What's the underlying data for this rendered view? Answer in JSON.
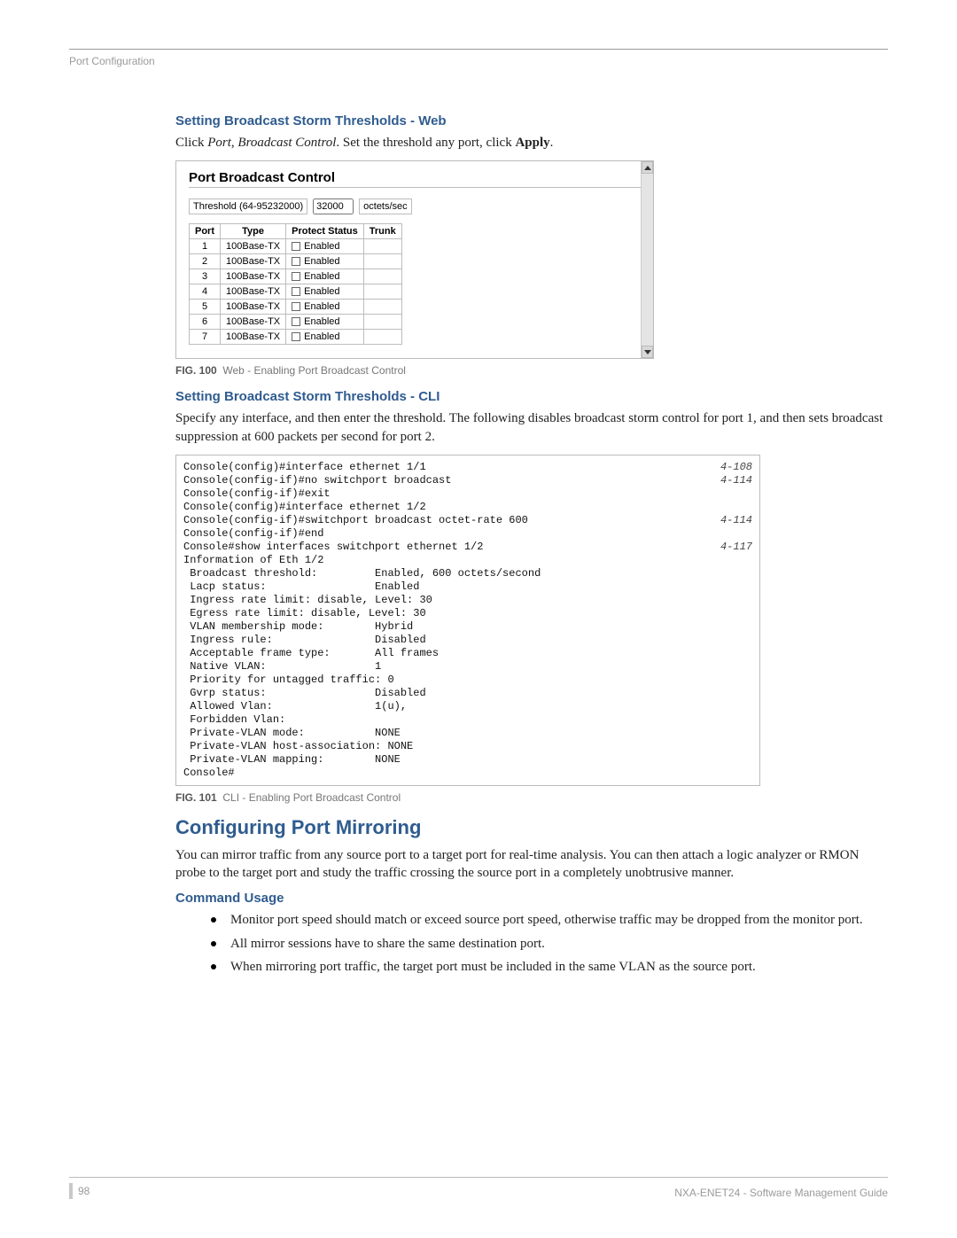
{
  "runningHead": "Port Configuration",
  "section1": {
    "heading": "Setting Broadcast Storm Thresholds - Web",
    "intro_prefix": "Click ",
    "intro_em1": "Port",
    "intro_mid": ", ",
    "intro_em2": "Broadcast Control",
    "intro_suffix": ". Set the threshold any port, click ",
    "intro_bold": "Apply",
    "intro_end": "."
  },
  "webui": {
    "title": "Port Broadcast Control",
    "threshold_label": "Threshold (64-95232000)",
    "threshold_value": "32000",
    "threshold_unit": "octets/sec",
    "cols": {
      "port": "Port",
      "type": "Type",
      "protect": "Protect Status",
      "trunk": "Trunk"
    },
    "rows": [
      {
        "port": "1",
        "type": "100Base-TX",
        "status": "Enabled"
      },
      {
        "port": "2",
        "type": "100Base-TX",
        "status": "Enabled"
      },
      {
        "port": "3",
        "type": "100Base-TX",
        "status": "Enabled"
      },
      {
        "port": "4",
        "type": "100Base-TX",
        "status": "Enabled"
      },
      {
        "port": "5",
        "type": "100Base-TX",
        "status": "Enabled"
      },
      {
        "port": "6",
        "type": "100Base-TX",
        "status": "Enabled"
      },
      {
        "port": "7",
        "type": "100Base-TX",
        "status": "Enabled"
      }
    ]
  },
  "fig1": {
    "label": "FIG. 100",
    "caption": "Web - Enabling Port Broadcast Control"
  },
  "section2": {
    "heading": "Setting Broadcast Storm Thresholds - CLI",
    "para": "Specify any interface, and then enter the threshold. The following disables broadcast storm control for port 1, and then sets broadcast suppression at 600 packets per second for port 2."
  },
  "cli": {
    "refs": {
      "r1": "4-108",
      "r2": "4-114",
      "r3": "4-114",
      "r4": "4-117"
    },
    "lines": {
      "l1": "Console(config)#interface ethernet 1/1",
      "l2": "Console(config-if)#no switchport broadcast",
      "l3": "Console(config-if)#exit",
      "l4": "Console(config)#interface ethernet 1/2",
      "l5": "Console(config-if)#switchport broadcast octet-rate 600",
      "l6": "Console(config-if)#end",
      "l7": "Console#show interfaces switchport ethernet 1/2",
      "l8": "Information of Eth 1/2",
      "l9": " Broadcast threshold:         Enabled, 600 octets/second",
      "l10": " Lacp status:                 Enabled",
      "l11": " Ingress rate limit: disable, Level: 30",
      "l12": " Egress rate limit: disable, Level: 30",
      "l13": " VLAN membership mode:        Hybrid",
      "l14": " Ingress rule:                Disabled",
      "l15": " Acceptable frame type:       All frames",
      "l16": " Native VLAN:                 1",
      "l17": " Priority for untagged traffic: 0",
      "l18": " Gvrp status:                 Disabled",
      "l19": " Allowed Vlan:                1(u),",
      "l20": " Forbidden Vlan:",
      "l21": " Private-VLAN mode:           NONE",
      "l22": " Private-VLAN host-association: NONE",
      "l23": " Private-VLAN mapping:        NONE",
      "l24": "Console#"
    }
  },
  "fig2": {
    "label": "FIG. 101",
    "caption": "CLI - Enabling Port Broadcast Control"
  },
  "section3": {
    "heading": "Configuring Port Mirroring",
    "para": "You can mirror traffic from any source port to a target port for real-time analysis. You can then attach a logic analyzer or RMON probe to the target port and study the traffic crossing the source port in a completely unobtrusive manner."
  },
  "usage": {
    "heading": "Command Usage",
    "b1": "Monitor port speed should match or exceed source port speed, otherwise traffic may be dropped from the monitor port.",
    "b2": "All mirror sessions have to share the same destination port.",
    "b3": "When mirroring port traffic, the target port must be included in the same VLAN as the source port."
  },
  "footer": {
    "page": "98",
    "doc": "NXA-ENET24 - Software Management Guide"
  }
}
